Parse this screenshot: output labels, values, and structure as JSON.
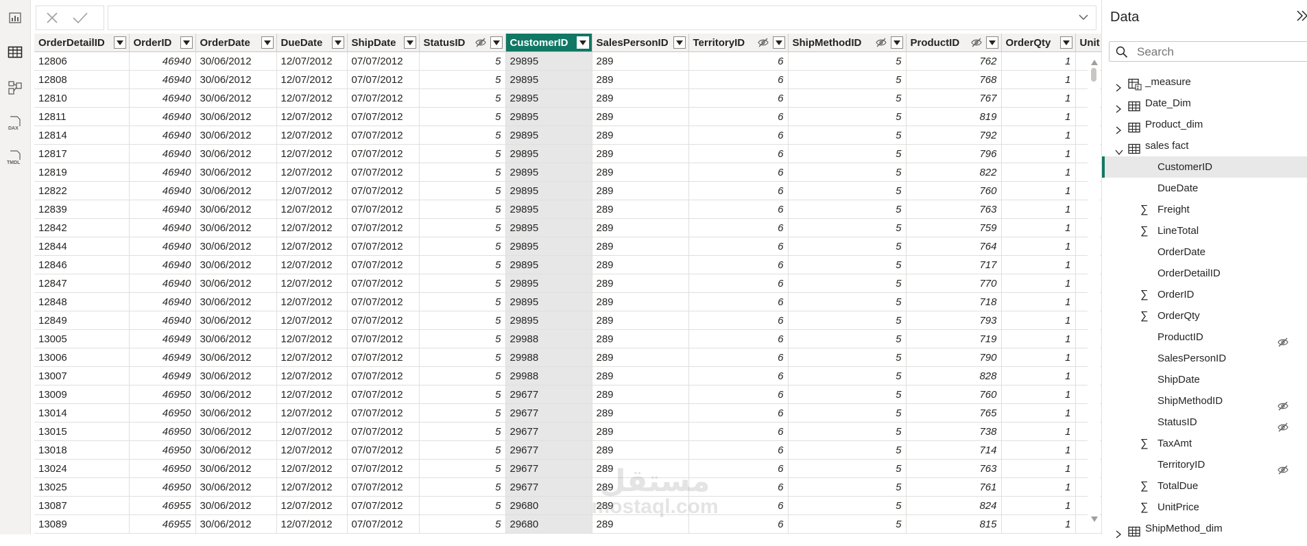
{
  "rail": {
    "items": [
      {
        "name": "report-view-icon"
      },
      {
        "name": "table-view-icon"
      },
      {
        "name": "model-view-icon"
      },
      {
        "name": "dax-query-view-icon",
        "label": "DAX"
      },
      {
        "name": "tmdl-view-icon",
        "label": "TMDL"
      }
    ]
  },
  "grid": {
    "columns": [
      {
        "label": "OrderDetailID",
        "hidden": false,
        "selected": false,
        "numeric": false,
        "width": 138
      },
      {
        "label": "OrderID",
        "hidden": false,
        "selected": false,
        "numeric": true,
        "width": 97
      },
      {
        "label": "OrderDate",
        "hidden": false,
        "selected": false,
        "numeric": false,
        "width": 118
      },
      {
        "label": "DueDate",
        "hidden": false,
        "selected": false,
        "numeric": false,
        "width": 103
      },
      {
        "label": "ShipDate",
        "hidden": false,
        "selected": false,
        "numeric": false,
        "width": 105
      },
      {
        "label": "StatusID",
        "hidden": true,
        "selected": false,
        "numeric": true,
        "width": 126
      },
      {
        "label": "CustomerID",
        "hidden": false,
        "selected": true,
        "numeric": false,
        "width": 126
      },
      {
        "label": "SalesPersonID",
        "hidden": false,
        "selected": false,
        "numeric": false,
        "width": 141
      },
      {
        "label": "TerritoryID",
        "hidden": true,
        "selected": false,
        "numeric": true,
        "width": 145
      },
      {
        "label": "ShipMethodID",
        "hidden": true,
        "selected": false,
        "numeric": true,
        "width": 172
      },
      {
        "label": "ProductID",
        "hidden": true,
        "selected": false,
        "numeric": true,
        "width": 139
      },
      {
        "label": "OrderQty",
        "hidden": false,
        "selected": false,
        "numeric": true,
        "width": 108
      },
      {
        "label": "Unit",
        "hidden": false,
        "selected": false,
        "numeric": false,
        "width": 60
      }
    ],
    "rows": [
      [
        "12806",
        "46940",
        "30/06/2012",
        "12/07/2012",
        "07/07/2012",
        "5",
        "29895",
        "289",
        "6",
        "5",
        "762",
        "1",
        ""
      ],
      [
        "12808",
        "46940",
        "30/06/2012",
        "12/07/2012",
        "07/07/2012",
        "5",
        "29895",
        "289",
        "6",
        "5",
        "768",
        "1",
        ""
      ],
      [
        "12810",
        "46940",
        "30/06/2012",
        "12/07/2012",
        "07/07/2012",
        "5",
        "29895",
        "289",
        "6",
        "5",
        "767",
        "1",
        ""
      ],
      [
        "12811",
        "46940",
        "30/06/2012",
        "12/07/2012",
        "07/07/2012",
        "5",
        "29895",
        "289",
        "6",
        "5",
        "819",
        "1",
        ""
      ],
      [
        "12814",
        "46940",
        "30/06/2012",
        "12/07/2012",
        "07/07/2012",
        "5",
        "29895",
        "289",
        "6",
        "5",
        "792",
        "1",
        ""
      ],
      [
        "12817",
        "46940",
        "30/06/2012",
        "12/07/2012",
        "07/07/2012",
        "5",
        "29895",
        "289",
        "6",
        "5",
        "796",
        "1",
        ""
      ],
      [
        "12819",
        "46940",
        "30/06/2012",
        "12/07/2012",
        "07/07/2012",
        "5",
        "29895",
        "289",
        "6",
        "5",
        "822",
        "1",
        ""
      ],
      [
        "12822",
        "46940",
        "30/06/2012",
        "12/07/2012",
        "07/07/2012",
        "5",
        "29895",
        "289",
        "6",
        "5",
        "760",
        "1",
        ""
      ],
      [
        "12839",
        "46940",
        "30/06/2012",
        "12/07/2012",
        "07/07/2012",
        "5",
        "29895",
        "289",
        "6",
        "5",
        "763",
        "1",
        ""
      ],
      [
        "12842",
        "46940",
        "30/06/2012",
        "12/07/2012",
        "07/07/2012",
        "5",
        "29895",
        "289",
        "6",
        "5",
        "759",
        "1",
        ""
      ],
      [
        "12844",
        "46940",
        "30/06/2012",
        "12/07/2012",
        "07/07/2012",
        "5",
        "29895",
        "289",
        "6",
        "5",
        "764",
        "1",
        ""
      ],
      [
        "12846",
        "46940",
        "30/06/2012",
        "12/07/2012",
        "07/07/2012",
        "5",
        "29895",
        "289",
        "6",
        "5",
        "717",
        "1",
        ""
      ],
      [
        "12847",
        "46940",
        "30/06/2012",
        "12/07/2012",
        "07/07/2012",
        "5",
        "29895",
        "289",
        "6",
        "5",
        "770",
        "1",
        ""
      ],
      [
        "12848",
        "46940",
        "30/06/2012",
        "12/07/2012",
        "07/07/2012",
        "5",
        "29895",
        "289",
        "6",
        "5",
        "718",
        "1",
        ""
      ],
      [
        "12849",
        "46940",
        "30/06/2012",
        "12/07/2012",
        "07/07/2012",
        "5",
        "29895",
        "289",
        "6",
        "5",
        "793",
        "1",
        ""
      ],
      [
        "13005",
        "46949",
        "30/06/2012",
        "12/07/2012",
        "07/07/2012",
        "5",
        "29988",
        "289",
        "6",
        "5",
        "719",
        "1",
        ""
      ],
      [
        "13006",
        "46949",
        "30/06/2012",
        "12/07/2012",
        "07/07/2012",
        "5",
        "29988",
        "289",
        "6",
        "5",
        "790",
        "1",
        ""
      ],
      [
        "13007",
        "46949",
        "30/06/2012",
        "12/07/2012",
        "07/07/2012",
        "5",
        "29988",
        "289",
        "6",
        "5",
        "828",
        "1",
        ""
      ],
      [
        "13009",
        "46950",
        "30/06/2012",
        "12/07/2012",
        "07/07/2012",
        "5",
        "29677",
        "289",
        "6",
        "5",
        "760",
        "1",
        ""
      ],
      [
        "13014",
        "46950",
        "30/06/2012",
        "12/07/2012",
        "07/07/2012",
        "5",
        "29677",
        "289",
        "6",
        "5",
        "765",
        "1",
        ""
      ],
      [
        "13015",
        "46950",
        "30/06/2012",
        "12/07/2012",
        "07/07/2012",
        "5",
        "29677",
        "289",
        "6",
        "5",
        "738",
        "1",
        ""
      ],
      [
        "13018",
        "46950",
        "30/06/2012",
        "12/07/2012",
        "07/07/2012",
        "5",
        "29677",
        "289",
        "6",
        "5",
        "714",
        "1",
        ""
      ],
      [
        "13024",
        "46950",
        "30/06/2012",
        "12/07/2012",
        "07/07/2012",
        "5",
        "29677",
        "289",
        "6",
        "5",
        "763",
        "1",
        ""
      ],
      [
        "13025",
        "46950",
        "30/06/2012",
        "12/07/2012",
        "07/07/2012",
        "5",
        "29677",
        "289",
        "6",
        "5",
        "761",
        "1",
        ""
      ],
      [
        "13087",
        "46955",
        "30/06/2012",
        "12/07/2012",
        "07/07/2012",
        "5",
        "29680",
        "289",
        "6",
        "5",
        "824",
        "1",
        ""
      ],
      [
        "13089",
        "46955",
        "30/06/2012",
        "12/07/2012",
        "07/07/2012",
        "5",
        "29680",
        "289",
        "6",
        "5",
        "815",
        "1",
        ""
      ]
    ]
  },
  "watermark": {
    "arabic": "مستقل",
    "latin": "mostaql.com"
  },
  "pane": {
    "title": "Data",
    "search_placeholder": "Search",
    "tree": [
      {
        "type": "table",
        "label": "_measure",
        "expanded": false,
        "icon": "measure-table-icon"
      },
      {
        "type": "table",
        "label": "Date_Dim",
        "expanded": false,
        "icon": "table-icon"
      },
      {
        "type": "table",
        "label": "Product_dim",
        "expanded": false,
        "icon": "table-icon"
      },
      {
        "type": "table",
        "label": "sales fact",
        "expanded": true,
        "icon": "table-icon"
      },
      {
        "type": "field",
        "label": "CustomerID",
        "sigma": false,
        "hidden": false,
        "selected": true
      },
      {
        "type": "field",
        "label": "DueDate",
        "sigma": false,
        "hidden": false,
        "selected": false
      },
      {
        "type": "field",
        "label": "Freight",
        "sigma": true,
        "hidden": false,
        "selected": false
      },
      {
        "type": "field",
        "label": "LineTotal",
        "sigma": true,
        "hidden": false,
        "selected": false
      },
      {
        "type": "field",
        "label": "OrderDate",
        "sigma": false,
        "hidden": false,
        "selected": false
      },
      {
        "type": "field",
        "label": "OrderDetailID",
        "sigma": false,
        "hidden": false,
        "selected": false
      },
      {
        "type": "field",
        "label": "OrderID",
        "sigma": true,
        "hidden": false,
        "selected": false
      },
      {
        "type": "field",
        "label": "OrderQty",
        "sigma": true,
        "hidden": false,
        "selected": false
      },
      {
        "type": "field",
        "label": "ProductID",
        "sigma": false,
        "hidden": true,
        "selected": false
      },
      {
        "type": "field",
        "label": "SalesPersonID",
        "sigma": false,
        "hidden": false,
        "selected": false
      },
      {
        "type": "field",
        "label": "ShipDate",
        "sigma": false,
        "hidden": false,
        "selected": false
      },
      {
        "type": "field",
        "label": "ShipMethodID",
        "sigma": false,
        "hidden": true,
        "selected": false
      },
      {
        "type": "field",
        "label": "StatusID",
        "sigma": false,
        "hidden": true,
        "selected": false
      },
      {
        "type": "field",
        "label": "TaxAmt",
        "sigma": true,
        "hidden": false,
        "selected": false
      },
      {
        "type": "field",
        "label": "TerritoryID",
        "sigma": false,
        "hidden": true,
        "selected": false
      },
      {
        "type": "field",
        "label": "TotalDue",
        "sigma": true,
        "hidden": false,
        "selected": false
      },
      {
        "type": "field",
        "label": "UnitPrice",
        "sigma": true,
        "hidden": false,
        "selected": false
      },
      {
        "type": "table",
        "label": "ShipMethod_dim",
        "expanded": false,
        "icon": "table-icon"
      }
    ]
  },
  "colors": {
    "accent": "#117865",
    "selected_column_bg": "#e7e7e7"
  }
}
